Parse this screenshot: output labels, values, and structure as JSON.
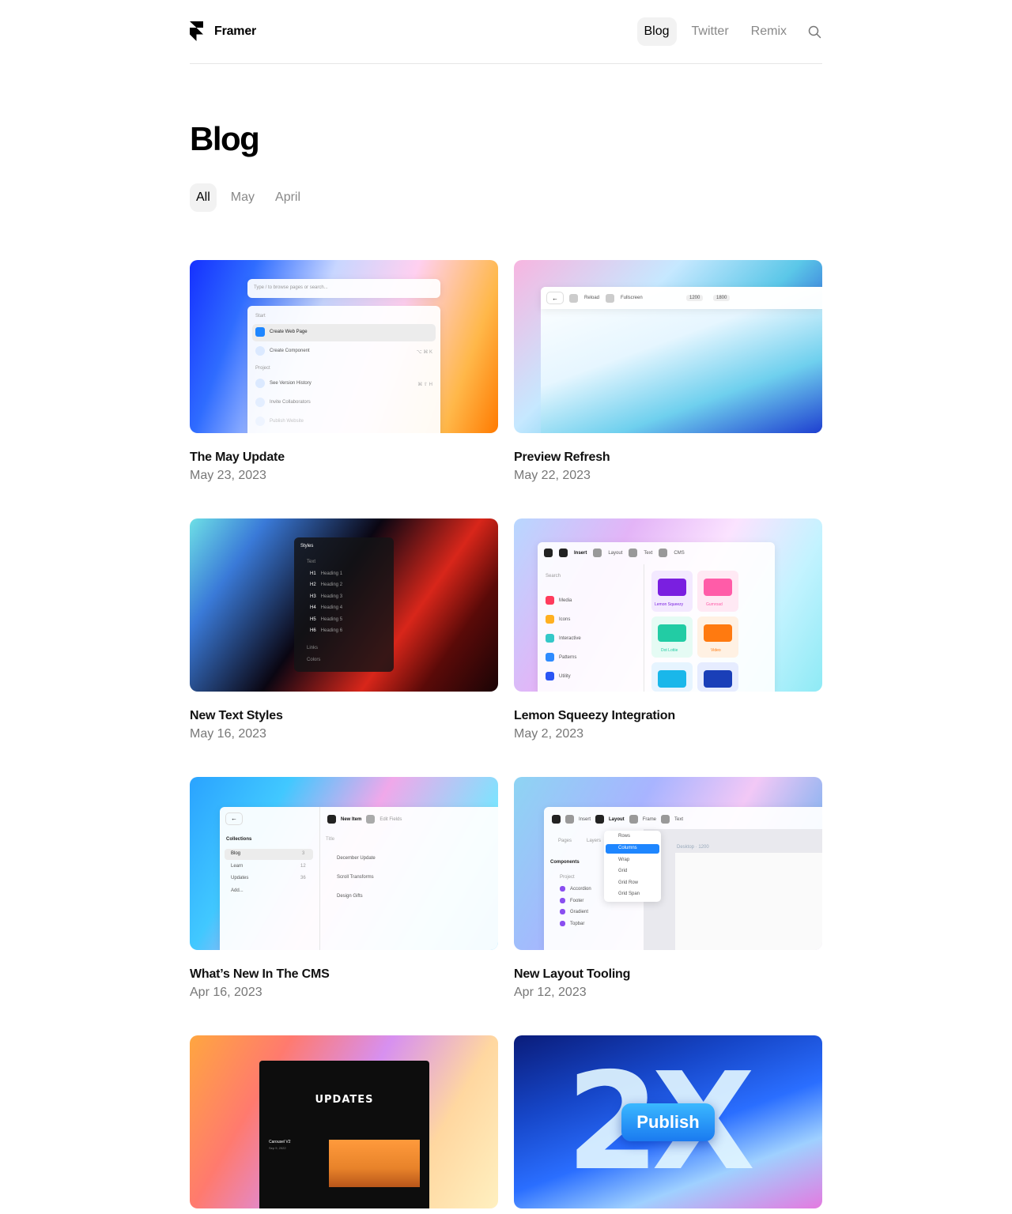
{
  "header": {
    "brand": "Framer",
    "nav": [
      {
        "label": "Blog",
        "active": true
      },
      {
        "label": "Twitter",
        "active": false
      },
      {
        "label": "Remix",
        "active": false
      }
    ],
    "search_icon": "search-icon"
  },
  "page": {
    "title": "Blog",
    "filters": [
      {
        "label": "All",
        "active": true
      },
      {
        "label": "May",
        "active": false
      },
      {
        "label": "April",
        "active": false
      }
    ]
  },
  "posts": [
    {
      "title": "The May Update",
      "date": "May 23, 2023"
    },
    {
      "title": "Preview Refresh",
      "date": "May 22, 2023"
    },
    {
      "title": "New Text Styles",
      "date": "May 16, 2023"
    },
    {
      "title": "Lemon Squeezy Integration",
      "date": "May 2, 2023"
    },
    {
      "title": "What’s New In The CMS",
      "date": "Apr 16, 2023"
    },
    {
      "title": "New Layout Tooling",
      "date": "Apr 12, 2023"
    },
    {
      "title": "",
      "date": ""
    },
    {
      "title": "",
      "date": ""
    }
  ],
  "thumbs": {
    "t1": {
      "search_placeholder": "Type / to browse pages or search...",
      "section_start": "Start",
      "create_web_page": "Create Web Page",
      "create_component": "Create Component",
      "create_component_kbd": "⌥ ⌘ K",
      "section_project": "Project",
      "see_version_history": "See Version History",
      "see_version_history_kbd": "⌘ ⇧ H",
      "invite_collaborators": "Invite Collaborators",
      "publish_website": "Publish Website"
    },
    "t2": {
      "reload": "Reload",
      "fullscreen": "Fullscreen",
      "w": "1200",
      "h": "1800"
    },
    "t3": {
      "panel_title": "Styles",
      "text_group": "Text",
      "headings": [
        {
          "tag": "H1",
          "label": "Heading 1"
        },
        {
          "tag": "H2",
          "label": "Heading 2"
        },
        {
          "tag": "H3",
          "label": "Heading 3"
        },
        {
          "tag": "H4",
          "label": "Heading 4"
        },
        {
          "tag": "H5",
          "label": "Heading 5"
        },
        {
          "tag": "H6",
          "label": "Heading 6"
        }
      ],
      "links": "Links",
      "colors": "Colors"
    },
    "t4": {
      "tabs": [
        "Insert",
        "Layout",
        "Text",
        "CMS"
      ],
      "search": "Search",
      "items": [
        "Media",
        "Icons",
        "Interactive",
        "Patterns",
        "Utility"
      ],
      "tiles": [
        "Lemon Squeezy",
        "Gumroad",
        "Dot Lottie",
        "Video"
      ]
    },
    "t5": {
      "collections": "Collections",
      "list": [
        {
          "name": "Blog",
          "count": "3"
        },
        {
          "name": "Learn",
          "count": "12"
        },
        {
          "name": "Updates",
          "count": "36"
        }
      ],
      "add": "Add...",
      "new_item": "New Item",
      "edit_fields": "Edit Fields",
      "title_col": "Title",
      "rows": [
        "December Update",
        "Scroll Transforms",
        "Design Gifts"
      ]
    },
    "t6": {
      "tabs": [
        "Insert",
        "Layout",
        "Frame",
        "Text"
      ],
      "pages": "Pages",
      "layers": "Layers",
      "components": "Components",
      "project": "Project",
      "comp_list": [
        "Accordion",
        "Footer",
        "Gradient",
        "Topbar"
      ],
      "menu": [
        "Rows",
        "Columns",
        "Wrap",
        "Grid",
        "Grid Row",
        "Grid Span"
      ],
      "desktop": "Desktop · 1200"
    },
    "t7": {
      "heading": "UPDATES",
      "caption": "Carousel V2",
      "caption_date": "Sep 9, 2022"
    },
    "t8": {
      "big": "2X",
      "button": "Publish"
    }
  },
  "colors": {
    "accent": "#1e86ff",
    "muted": "#888888",
    "active_bg": "#f2f2f2"
  }
}
